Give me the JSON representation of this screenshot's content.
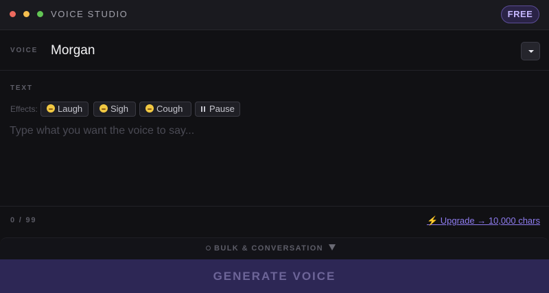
{
  "window": {
    "title": "VOICE STUDIO",
    "plan_badge": "FREE"
  },
  "voice": {
    "label": "VOICE",
    "selected": "Morgan",
    "dropdown_icon": "caret-down-icon"
  },
  "text": {
    "label": "TEXT",
    "effects_label": "Effects:",
    "effects": [
      {
        "label": "Laugh",
        "icon": "laugh-emoji-icon"
      },
      {
        "label": "Sigh",
        "icon": "sigh-emoji-icon"
      },
      {
        "label": "Cough",
        "icon": "cough-emoji-icon"
      },
      {
        "label": "Pause",
        "icon": "pause-icon"
      }
    ],
    "placeholder": "Type what you want the voice to say...",
    "value": ""
  },
  "footer": {
    "char_count": "0 / 99",
    "upgrade_link": "⚡ Upgrade → 10,000 chars"
  },
  "bulk": {
    "label": "BULK & CONVERSATION"
  },
  "generate": {
    "label": "GENERATE VOICE"
  },
  "colors": {
    "background": "#111114",
    "accent": "#8f7cf0",
    "button_bg": "#2d2755",
    "badge_bg": "#2a2346"
  }
}
